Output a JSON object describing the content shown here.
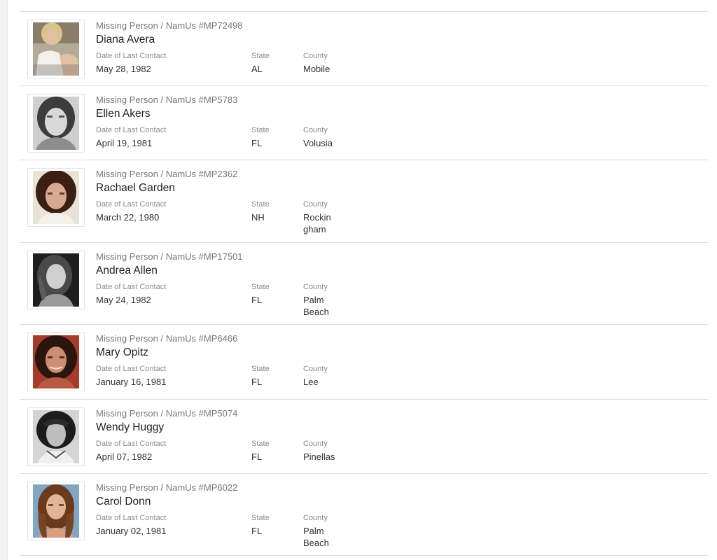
{
  "results": [
    {
      "case_type": "Missing Person / NamUs #MP72498",
      "name": "Diana Avera",
      "date_label": "Date of Last Contact",
      "date": "May 28, 1982",
      "state_label": "State",
      "state": "AL",
      "county_label": "County",
      "county": "Mobile",
      "photo": "photo-1"
    },
    {
      "case_type": "Missing Person / NamUs #MP5783",
      "name": "Ellen Akers",
      "date_label": "Date of Last Contact",
      "date": "April 19, 1981",
      "state_label": "State",
      "state": "FL",
      "county_label": "County",
      "county": "Volusia",
      "photo": "photo-2"
    },
    {
      "case_type": "Missing Person / NamUs #MP2362",
      "name": "Rachael Garden",
      "date_label": "Date of Last Contact",
      "date": "March 22, 1980",
      "state_label": "State",
      "state": "NH",
      "county_label": "County",
      "county_lines": [
        "Rockin",
        "gham"
      ],
      "photo": "photo-3"
    },
    {
      "case_type": "Missing Person / NamUs #MP17501",
      "name": "Andrea Allen",
      "date_label": "Date of Last Contact",
      "date": "May 24, 1982",
      "state_label": "State",
      "state": "FL",
      "county_label": "County",
      "county_lines": [
        "Palm",
        "Beach"
      ],
      "photo": "photo-4"
    },
    {
      "case_type": "Missing Person / NamUs #MP6466",
      "name": "Mary Opitz",
      "date_label": "Date of Last Contact",
      "date": "January 16, 1981",
      "state_label": "State",
      "state": "FL",
      "county_label": "County",
      "county": "Lee",
      "photo": "photo-5"
    },
    {
      "case_type": "Missing Person / NamUs #MP5074",
      "name": "Wendy Huggy",
      "date_label": "Date of Last Contact",
      "date": "April 07, 1982",
      "state_label": "State",
      "state": "FL",
      "county_label": "County",
      "county": "Pinellas",
      "photo": "photo-6"
    },
    {
      "case_type": "Missing Person / NamUs #MP6022",
      "name": "Carol Donn",
      "date_label": "Date of Last Contact",
      "date": "January 02, 1981",
      "state_label": "State",
      "state": "FL",
      "county_label": "County",
      "county_lines": [
        "Palm",
        "Beach"
      ],
      "photo": "photo-7"
    }
  ]
}
